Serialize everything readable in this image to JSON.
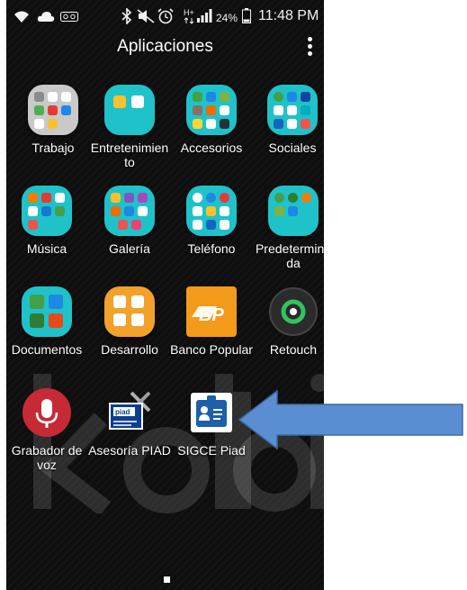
{
  "status_bar": {
    "battery": "24%",
    "time": "11:48 PM",
    "left_icons": [
      "wifi-icon",
      "cloud-icon",
      "voicemail-icon"
    ],
    "right_icons": [
      "bluetooth-icon",
      "mute-icon",
      "alarm-icon",
      "hplus-icon",
      "signal-icon",
      "battery-icon"
    ]
  },
  "header": {
    "title": "Aplicaciones",
    "menu_icon": "more-vert-icon"
  },
  "apps": [
    {
      "label": "Trabajo",
      "icon": "work-folder-icon"
    },
    {
      "label": "Entretenimien to",
      "icon": "entertainment-folder-icon"
    },
    {
      "label": "Accesorios",
      "icon": "accessories-folder-icon"
    },
    {
      "label": "Sociales",
      "icon": "social-folder-icon"
    },
    {
      "label": "Música",
      "icon": "music-folder-icon"
    },
    {
      "label": "Galería",
      "icon": "gallery-folder-icon"
    },
    {
      "label": "Teléfono",
      "icon": "phone-folder-icon"
    },
    {
      "label": "Predetermina da",
      "icon": "default-folder-icon"
    },
    {
      "label": "Documentos",
      "icon": "documents-folder-icon"
    },
    {
      "label": "Desarrollo",
      "icon": "development-folder-icon"
    },
    {
      "label": "Banco Popular",
      "icon": "bp-logo-icon",
      "icon_text": "BP"
    },
    {
      "label": "Retouch",
      "icon": "retouch-icon"
    },
    {
      "label": "Grabador de voz",
      "icon": "microphone-icon"
    },
    {
      "label": "Asesoría PIAD",
      "icon": "piad-tools-icon",
      "icon_text": "piad"
    },
    {
      "label": "SIGCE Piad",
      "icon": "id-badge-icon"
    }
  ],
  "watermark": "kolbi",
  "colors": {
    "teal": "#1fc2c9",
    "orange": "#f2a12b",
    "arrow": "#5b8ed1",
    "bp_orange": "#f39a1b",
    "mic_red": "#c62b35"
  }
}
